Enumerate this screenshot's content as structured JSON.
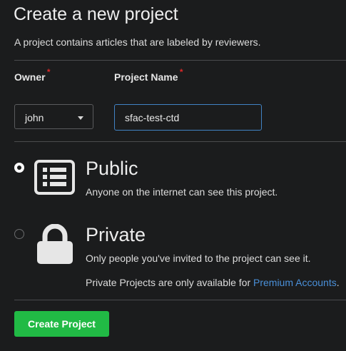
{
  "header": {
    "title": "Create a new project",
    "subtitle": "A project contains articles that are labeled by reviewers."
  },
  "form": {
    "owner_label": "Owner",
    "owner_value": "john",
    "project_name_label": "Project Name",
    "project_name_value": "sfac-test-ctd",
    "required_marker": "*"
  },
  "visibility": {
    "public": {
      "title": "Public",
      "description": "Anyone on the internet can see this project.",
      "selected": true,
      "icon": "list-alternate-icon"
    },
    "private": {
      "title": "Private",
      "description": "Only people you've invited to the project can see it.",
      "note_prefix": "Private Projects are only available for ",
      "note_link": "Premium Accounts",
      "note_suffix": ".",
      "selected": false,
      "icon": "lock-icon"
    }
  },
  "actions": {
    "create_label": "Create Project"
  },
  "colors": {
    "background": "#1b1c1d",
    "accent_green": "#21ba45",
    "link_blue": "#4a90d9",
    "required_red": "#db2828",
    "input_focus_border": "#4183c4"
  }
}
